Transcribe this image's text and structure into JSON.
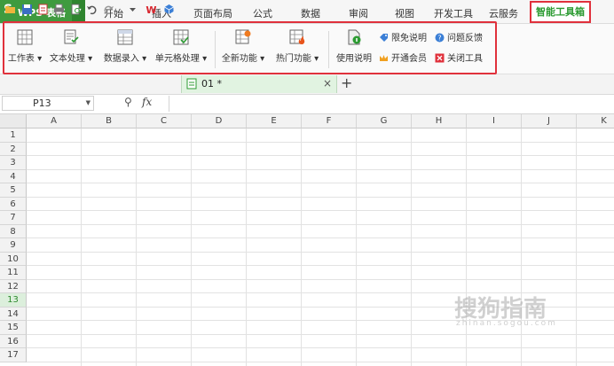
{
  "app": {
    "logo": "S",
    "name": "WPS 表格"
  },
  "menu": {
    "items": [
      "开始",
      "插入",
      "页面布局",
      "公式",
      "数据",
      "审阅",
      "视图",
      "开发工具",
      "云服务"
    ],
    "active": "智能工具箱"
  },
  "ribbon": {
    "buttons": [
      "工作表",
      "文本处理",
      "数据录入",
      "单元格处理",
      "全新功能",
      "热门功能"
    ],
    "usage": "使用说明",
    "small": [
      "限免说明",
      "问题反馈",
      "开通会员",
      "关闭工具"
    ]
  },
  "toolbar": {
    "doc_tab": "01 *",
    "close": "×",
    "new_tab": "+"
  },
  "formula": {
    "cell_ref": "P13",
    "fx": "fx",
    "value": ""
  },
  "grid": {
    "columns": [
      "A",
      "B",
      "C",
      "D",
      "E",
      "F",
      "G",
      "H",
      "I",
      "J",
      "K"
    ],
    "rows": [
      "1",
      "2",
      "3",
      "4",
      "5",
      "6",
      "7",
      "8",
      "9",
      "10",
      "11",
      "12",
      "13",
      "14",
      "15",
      "16",
      "17"
    ],
    "selected_row": "13"
  },
  "watermark": {
    "text": "搜狗指南",
    "sub": "zhinan.sogou.com"
  },
  "colors": {
    "accent": "#3f9b3f",
    "highlight": "#e0313c",
    "active_text": "#2c9b32"
  }
}
